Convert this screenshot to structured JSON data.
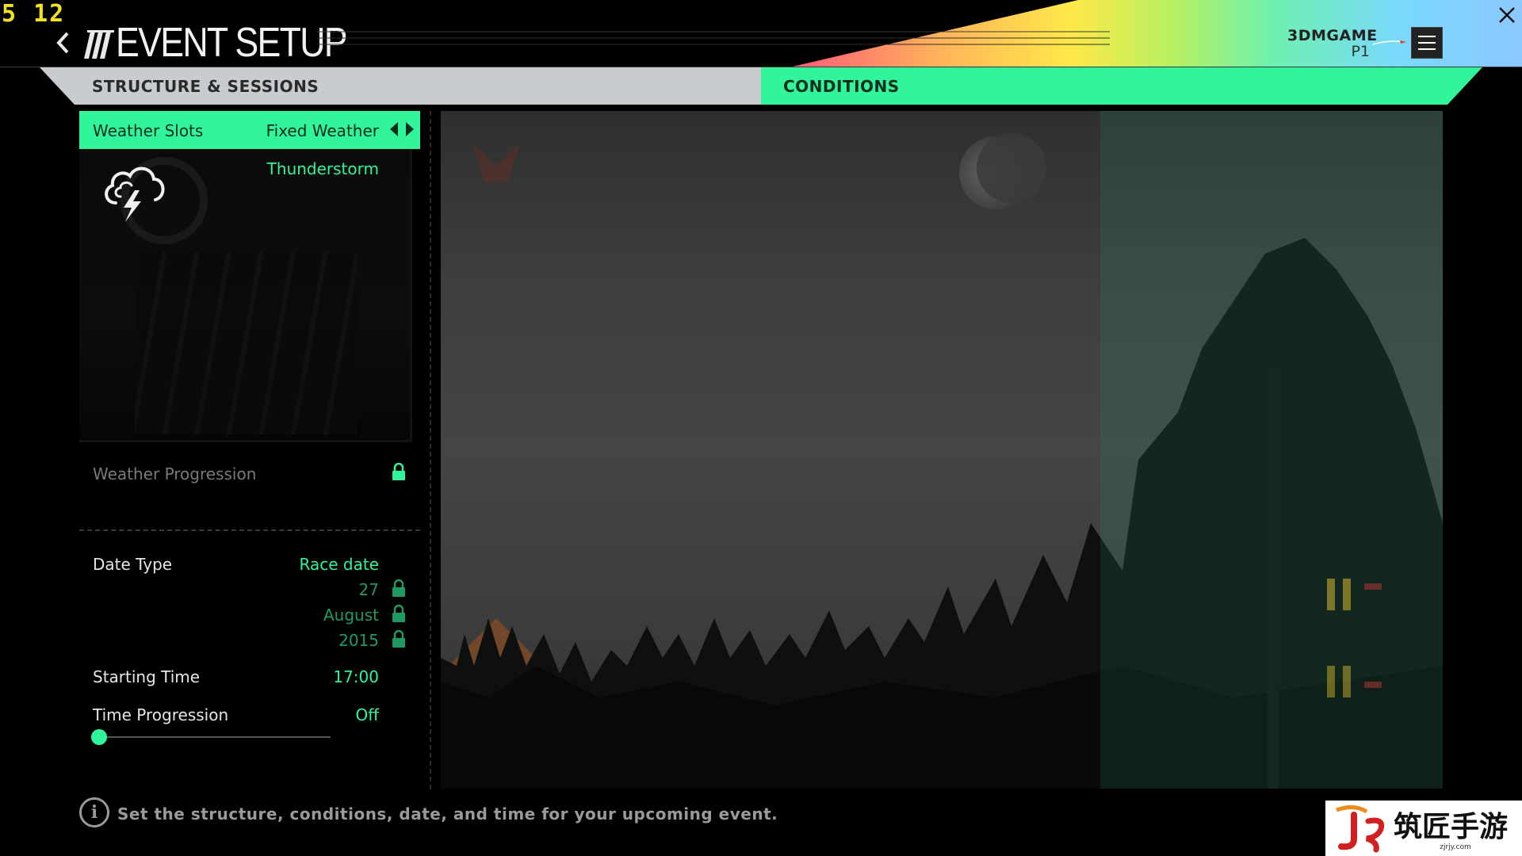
{
  "overlay": {
    "fps": "5 12"
  },
  "header": {
    "title": "EVENT SETUP",
    "user_name": "3DMGAME",
    "user_rank": "P1"
  },
  "tabs": [
    {
      "label": "STRUCTURE & SESSIONS",
      "active": false
    },
    {
      "label": "CONDITIONS",
      "active": true
    }
  ],
  "settings": {
    "weather_slots": {
      "label": "Weather Slots",
      "value": "Fixed Weather"
    },
    "weather": {
      "name": "Thunderstorm",
      "icon": "thunderstorm-icon"
    },
    "weather_progression": {
      "label": "Weather Progression",
      "locked": true
    },
    "date_type": {
      "label": "Date Type",
      "value": "Race date"
    },
    "date": {
      "day": "27",
      "month": "August",
      "year": "2015"
    },
    "starting_time": {
      "label": "Starting Time",
      "value": "17:00"
    },
    "time_progression": {
      "label": "Time Progression",
      "value": "Off",
      "slider_level": 0
    }
  },
  "footer": {
    "help_text": "Set the structure, conditions, date, and time for your upcoming event."
  },
  "watermark": {
    "text": "筑匠手游",
    "url": "zjrjy.com"
  },
  "colors": {
    "accent": "#30f59a",
    "tab_inactive": "#c9ccce",
    "text_dim": "#7a7a7a"
  }
}
